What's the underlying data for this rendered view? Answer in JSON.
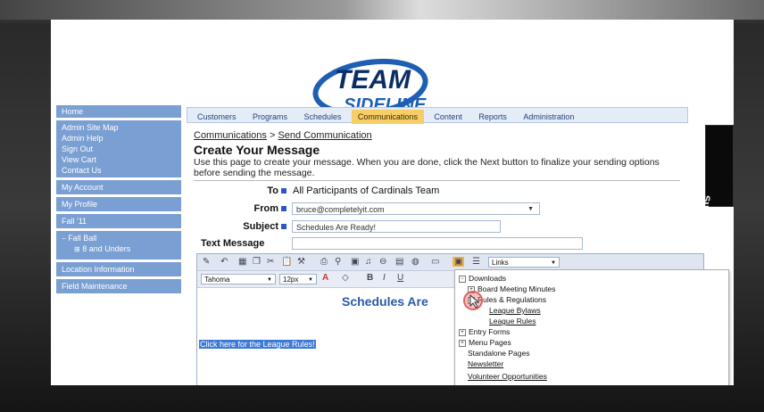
{
  "logo": {
    "line1": "TEAM",
    "line2": "SIDELINE"
  },
  "sidebar": {
    "items": [
      {
        "label": "Home"
      },
      {
        "label": "Admin Site Map"
      },
      {
        "label": "Admin Help"
      },
      {
        "label": "Sign Out"
      },
      {
        "label": "View Cart"
      },
      {
        "label": "Contact Us"
      },
      {
        "label": "My Account"
      },
      {
        "label": "My Profile"
      },
      {
        "label": "Fall '11"
      },
      {
        "label": "Fall Ball"
      },
      {
        "label": "8 and Unders"
      },
      {
        "label": "Location Information"
      },
      {
        "label": "Field Maintenance"
      }
    ]
  },
  "nav": {
    "tabs": [
      "Customers",
      "Programs",
      "Schedules",
      "Communications",
      "Content",
      "Reports",
      "Administration"
    ],
    "active": "Communications"
  },
  "breadcrumb": {
    "parent": "Communications",
    "separator": " > ",
    "current": "Send Communication"
  },
  "page": {
    "title": "Create Your Message",
    "description": "Use this page to create your message. When you are done, click the Next button to finalize your sending options before sending the message."
  },
  "form": {
    "to_label": "To",
    "to_value": "All Participants of Cardinals Team",
    "from_label": "From",
    "from_value": "bruce@completelyit.com",
    "subject_label": "Subject",
    "subject_value": "Schedules Are Ready!",
    "text_label": "Text Message"
  },
  "editor": {
    "font": "Tahoma",
    "size": "12px",
    "links_label": "Links",
    "body_heading": "Schedules Are",
    "selected_link": "Click here for the League Rules!"
  },
  "links_menu": {
    "items": [
      {
        "label": "Downloads"
      },
      {
        "label": "Board Meeting Minutes"
      },
      {
        "label": "Rules & Regulations"
      },
      {
        "label": "League Bylaws"
      },
      {
        "label": "League Rules"
      },
      {
        "label": "Entry Forms"
      },
      {
        "label": "Menu Pages"
      },
      {
        "label": "Standalone Pages"
      },
      {
        "label": "Newsletter"
      },
      {
        "label": "Volunteer Opportunities"
      }
    ]
  },
  "support": {
    "label": "Support"
  },
  "colors": {
    "sidebar": "#7a9fd2",
    "active_tab": "#f6cd66",
    "heading_blue": "#2a5aa8"
  }
}
